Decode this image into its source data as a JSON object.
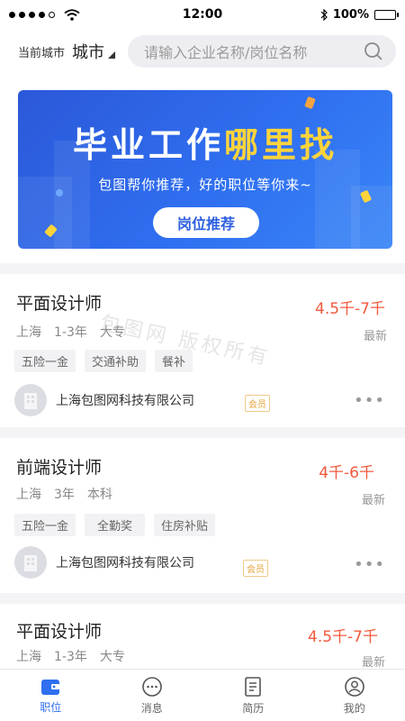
{
  "status_bar": {
    "time": "12:00",
    "battery": "100%"
  },
  "header": {
    "city_label": "当前城市",
    "city_value": "城市",
    "search_placeholder": "请输入企业名称/岗位名称"
  },
  "banner": {
    "title_main": "毕业工作",
    "title_highlight": "哪里找",
    "subtitle": "包图帮你推荐，好的职位等你来~",
    "button": "岗位推荐"
  },
  "watermark": "包图网 版权所有",
  "jobs": [
    {
      "title": "平面设计师",
      "salary": "4.5千-7千",
      "city": "上海",
      "experience": "1-3年",
      "education": "大专",
      "latest": "最新",
      "tags": [
        "五险一金",
        "交通补助",
        "餐补"
      ],
      "company": "上海包图网科技有限公司",
      "member_badge": "会员"
    },
    {
      "title": "前端设计师",
      "salary": "4千-6千",
      "city": "上海",
      "experience": "3年",
      "education": "本科",
      "latest": "最新",
      "tags": [
        "五险一金",
        "全勤奖",
        "住房补贴"
      ],
      "company": "上海包图网科技有限公司",
      "member_badge": "会员"
    },
    {
      "title": "平面设计师",
      "salary": "4.5千-7千",
      "city": "上海",
      "experience": "1-3年",
      "education": "大专",
      "latest": "最新"
    }
  ],
  "tabbar": [
    {
      "label": "职位",
      "icon": "briefcase-icon",
      "active": true
    },
    {
      "label": "消息",
      "icon": "message-icon",
      "active": false
    },
    {
      "label": "简历",
      "icon": "resume-icon",
      "active": false
    },
    {
      "label": "我的",
      "icon": "profile-icon",
      "active": false
    }
  ],
  "colors": {
    "accent": "#2f6ff0",
    "salary": "#f05a3c",
    "highlight": "#ffd43b"
  }
}
